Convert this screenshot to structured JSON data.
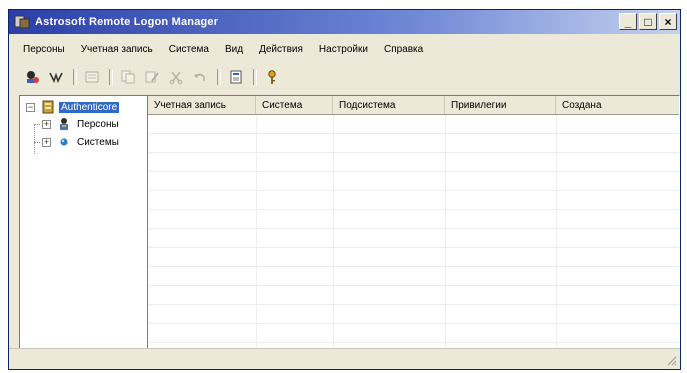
{
  "window": {
    "title": "Astrosoft Remote Logon Manager"
  },
  "controls": {
    "minimize": "_",
    "maximize": "□",
    "close": "×"
  },
  "menu": [
    "Персоны",
    "Учетная запись",
    "Система",
    "Вид",
    "Действия",
    "Настройки",
    "Справка"
  ],
  "toolbar": {
    "icons": [
      "person-connect-icon",
      "user-tool-icon",
      "properties-icon",
      "copy-icon",
      "edit-icon",
      "cut-icon",
      "undo-icon",
      "export-icon",
      "key-icon"
    ]
  },
  "tree": {
    "root": {
      "label": "Authenticore",
      "icon": "server-icon"
    },
    "children": [
      {
        "label": "Персоны",
        "icon": "persons-icon",
        "expander": "+"
      },
      {
        "label": "Системы",
        "icon": "system-icon",
        "expander": "+"
      }
    ],
    "root_expander": "−"
  },
  "list": {
    "columns": [
      "Учетная запись",
      "Система",
      "Подсистема",
      "Привилегии",
      "Создана"
    ],
    "rows": []
  },
  "colors": {
    "title_start": "#2b3fa8",
    "title_end": "#c6d2ef",
    "selection": "#316ac5",
    "chrome": "#ece9d8"
  }
}
